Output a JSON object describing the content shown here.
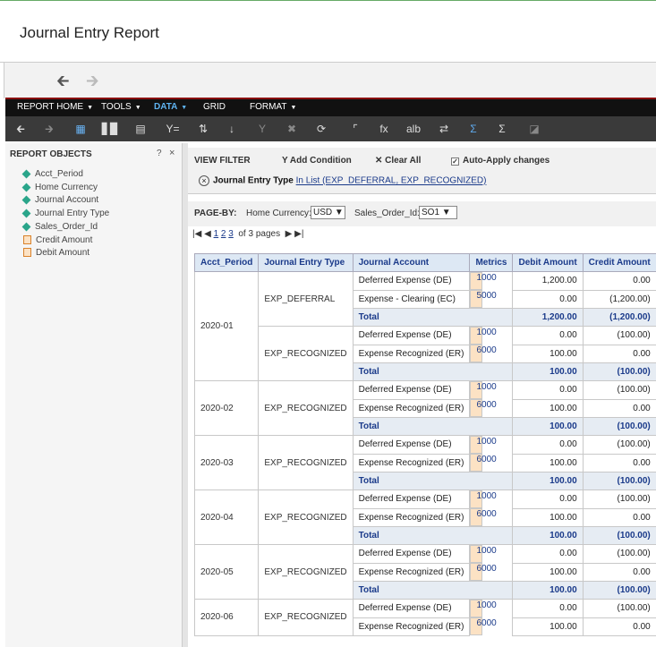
{
  "page_title": "Journal Entry Report",
  "menus": [
    {
      "label": "REPORT HOME",
      "caret": "▼"
    },
    {
      "label": "TOOLS",
      "caret": "▼"
    },
    {
      "label": "DATA",
      "caret": "▼"
    },
    {
      "label": "GRID",
      "caret": ""
    },
    {
      "label": "FORMAT",
      "caret": "▼"
    }
  ],
  "left_panel": {
    "heading": "REPORT OBJECTS",
    "help": "?",
    "close": "×",
    "attributes": [
      "Acct_Period",
      "Home Currency",
      "Journal Account",
      "Journal Entry Type",
      "Sales_Order_Id"
    ],
    "metrics": [
      "Credit Amount",
      "Debit Amount"
    ]
  },
  "view_filter": {
    "label": "VIEW FILTER",
    "add_condition": "Add Condition",
    "clear_all": "Clear All",
    "auto_apply": "Auto-Apply changes",
    "condition_field": "Journal Entry Type",
    "condition_value": "In List (EXP_DEFERRAL, EXP_RECOGNIZED)"
  },
  "page_by": {
    "label": "PAGE-BY:",
    "home_currency_label": "Home Currency:",
    "home_currency_value": "USD",
    "sales_order_label": "Sales_Order_Id:",
    "sales_order_value": "SO1"
  },
  "pager": {
    "pages": [
      "1",
      "2",
      "3"
    ],
    "of_text": "of 3 pages"
  },
  "table": {
    "headers": [
      "Acct_Period",
      "Journal Entry Type",
      "Journal Account",
      "Metrics",
      "Debit Amount",
      "Credit Amount"
    ],
    "rows": [
      {
        "period": "2020-01",
        "type": "EXP_DEFERRAL",
        "account": "Deferred Expense (DE)",
        "metric": "1000",
        "debit": "1,200.00",
        "credit": "0.00"
      },
      {
        "account": "Expense - Clearing (EC)",
        "metric": "5000",
        "debit": "0.00",
        "credit": "(1,200.00)"
      },
      {
        "total": "Total",
        "debit": "1,200.00",
        "credit": "(1,200.00)"
      },
      {
        "type": "EXP_RECOGNIZED",
        "account": "Deferred Expense (DE)",
        "metric": "1000",
        "debit": "0.00",
        "credit": "(100.00)"
      },
      {
        "account": "Expense Recognized (ER)",
        "metric": "6000",
        "debit": "100.00",
        "credit": "0.00"
      },
      {
        "total": "Total",
        "debit": "100.00",
        "credit": "(100.00)"
      },
      {
        "period": "2020-02",
        "type": "EXP_RECOGNIZED",
        "account": "Deferred Expense (DE)",
        "metric": "1000",
        "debit": "0.00",
        "credit": "(100.00)"
      },
      {
        "account": "Expense Recognized (ER)",
        "metric": "6000",
        "debit": "100.00",
        "credit": "0.00"
      },
      {
        "total": "Total",
        "debit": "100.00",
        "credit": "(100.00)"
      },
      {
        "period": "2020-03",
        "type": "EXP_RECOGNIZED",
        "account": "Deferred Expense (DE)",
        "metric": "1000",
        "debit": "0.00",
        "credit": "(100.00)"
      },
      {
        "account": "Expense Recognized (ER)",
        "metric": "6000",
        "debit": "100.00",
        "credit": "0.00"
      },
      {
        "total": "Total",
        "debit": "100.00",
        "credit": "(100.00)"
      },
      {
        "period": "2020-04",
        "type": "EXP_RECOGNIZED",
        "account": "Deferred Expense (DE)",
        "metric": "1000",
        "debit": "0.00",
        "credit": "(100.00)"
      },
      {
        "account": "Expense Recognized (ER)",
        "metric": "6000",
        "debit": "100.00",
        "credit": "0.00"
      },
      {
        "total": "Total",
        "debit": "100.00",
        "credit": "(100.00)"
      },
      {
        "period": "2020-05",
        "type": "EXP_RECOGNIZED",
        "account": "Deferred Expense (DE)",
        "metric": "1000",
        "debit": "0.00",
        "credit": "(100.00)"
      },
      {
        "account": "Expense Recognized (ER)",
        "metric": "6000",
        "debit": "100.00",
        "credit": "0.00"
      },
      {
        "total": "Total",
        "debit": "100.00",
        "credit": "(100.00)"
      },
      {
        "period": "2020-06",
        "type": "EXP_RECOGNIZED",
        "account": "Deferred Expense (DE)",
        "metric": "1000",
        "debit": "0.00",
        "credit": "(100.00)"
      },
      {
        "account": "Expense Recognized (ER)",
        "metric": "6000",
        "debit": "100.00",
        "credit": "0.00"
      }
    ]
  }
}
